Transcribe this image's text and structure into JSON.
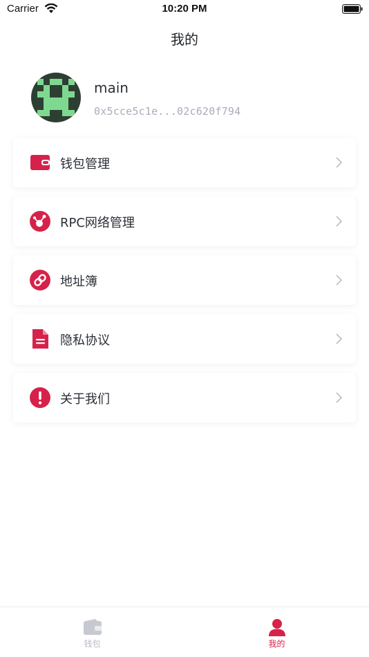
{
  "status_bar": {
    "carrier": "Carrier",
    "time": "10:20 PM"
  },
  "header": {
    "title": "我的"
  },
  "account": {
    "name": "main",
    "address": "0x5cce5c1e...02c620f794"
  },
  "menu": {
    "items": [
      {
        "label": "钱包管理",
        "icon": "wallet-icon"
      },
      {
        "label": "RPC网络管理",
        "icon": "network-icon"
      },
      {
        "label": "地址簿",
        "icon": "link-icon"
      },
      {
        "label": "隐私协议",
        "icon": "document-icon"
      },
      {
        "label": "关于我们",
        "icon": "info-icon"
      }
    ]
  },
  "tab_bar": {
    "tabs": [
      {
        "label": "钱包",
        "icon": "wallet-tab-icon",
        "active": false
      },
      {
        "label": "我的",
        "icon": "user-tab-icon",
        "active": true
      }
    ]
  },
  "colors": {
    "accent": "#d6224a",
    "inactive": "#b6bac3",
    "avatar_dark": "#2d3f33",
    "avatar_light": "#7fd890"
  }
}
